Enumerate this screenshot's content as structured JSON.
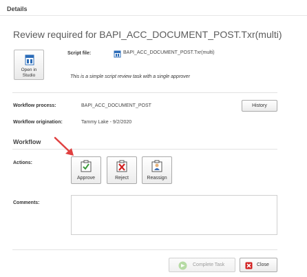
{
  "header": {
    "title": "Details"
  },
  "review": {
    "title": "Review required for BAPI_ACC_DOCUMENT_POST.Txr(multi)",
    "open_studio_label": "Open in Studio",
    "script_file_label": "Script file:",
    "script_file_name": "BAPI_ACC_DOCUMENT_POST.Txr(multi)",
    "description": "This is a simple script review task with a single approver"
  },
  "workflow_info": {
    "process_label": "Workflow process:",
    "process_value": "BAPI_ACC_DOCUMENT_POST",
    "origination_label": "Workflow origination:",
    "origination_value": "Tammy Lake - 9/2/2020",
    "history_button": "History"
  },
  "workflow": {
    "section_title": "Workflow",
    "actions_label": "Actions:",
    "actions": [
      {
        "label": "Approve",
        "icon": "approve-icon"
      },
      {
        "label": "Reject",
        "icon": "reject-icon"
      },
      {
        "label": "Reassign",
        "icon": "reassign-icon"
      }
    ],
    "comments_label": "Comments:",
    "comments_value": ""
  },
  "footer": {
    "complete_task_label": "Complete Task",
    "close_label": "Close"
  },
  "colors": {
    "approve": "#3a9a3a",
    "reject": "#d22020",
    "arrow": "#e04040",
    "doc_blue": "#2b6cb8"
  }
}
